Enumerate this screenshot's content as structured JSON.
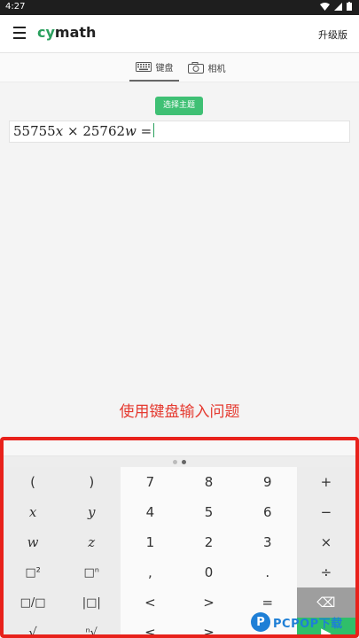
{
  "status_bar": {
    "time": "4:27"
  },
  "app_bar": {
    "logo_cy": "cy",
    "logo_math": "math",
    "upgrade_label": "升级版"
  },
  "tabs": [
    {
      "label": "键盘"
    },
    {
      "label": "相机"
    }
  ],
  "main": {
    "theme_button": "选择主题",
    "input": {
      "n1": "55755",
      "v1": "x",
      "times": "×",
      "n2": "25762",
      "v2": "w",
      "eq": "="
    },
    "hint": "使用键盘输入问题"
  },
  "keyboard": {
    "rows": [
      [
        "(",
        ")",
        "7",
        "8",
        "9",
        "+"
      ],
      [
        "x",
        "y",
        "4",
        "5",
        "6",
        "−"
      ],
      [
        "w",
        "z",
        "1",
        "2",
        "3",
        "×"
      ],
      [
        "□²",
        "□ⁿ",
        ",",
        "0",
        ".",
        "÷"
      ],
      [
        "□/□",
        "|□|",
        "<",
        ">",
        "=",
        "⌫"
      ],
      [
        "√",
        "ⁿ√",
        "≤",
        "≥",
        "",
        "▶"
      ]
    ]
  },
  "watermark": {
    "text": "PCPOP下载",
    "initial": "P"
  }
}
